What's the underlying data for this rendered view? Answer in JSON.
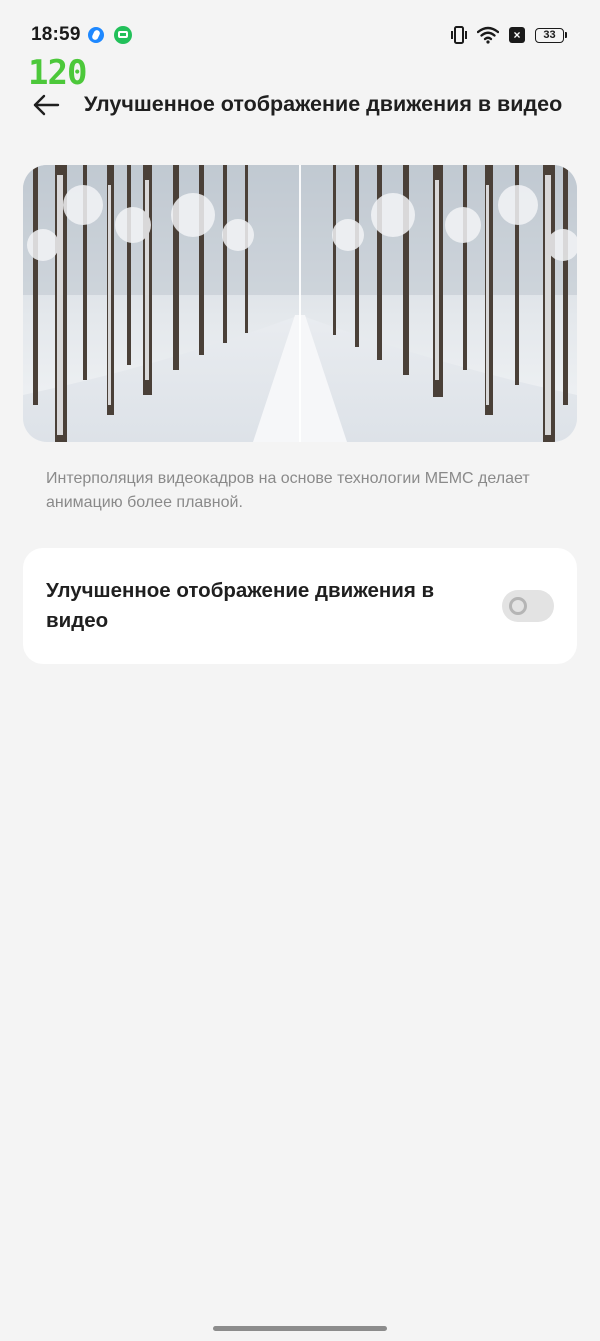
{
  "status_bar": {
    "time": "18:59",
    "battery_level": "33",
    "icons": [
      "app-notification-icon",
      "chat-notification-icon",
      "vibrate-icon",
      "wifi-icon",
      "no-sim-icon",
      "battery-icon"
    ]
  },
  "fps_counter": "120",
  "header": {
    "title": "Улучшенное отображение движения в видео",
    "back_icon": "arrow-left-icon"
  },
  "preview": {
    "description": "Интерполяция видеокадров на основе технологии MEMC делает анимацию более плавной."
  },
  "setting": {
    "label": "Улучшенное отображение движения в видео",
    "enabled": false
  },
  "colors": {
    "background": "#f4f4f4",
    "card": "#ffffff",
    "fps_green": "#4cc83a",
    "toggle_off": "#e3e3e3",
    "secondary_text": "#8a8a8a"
  }
}
